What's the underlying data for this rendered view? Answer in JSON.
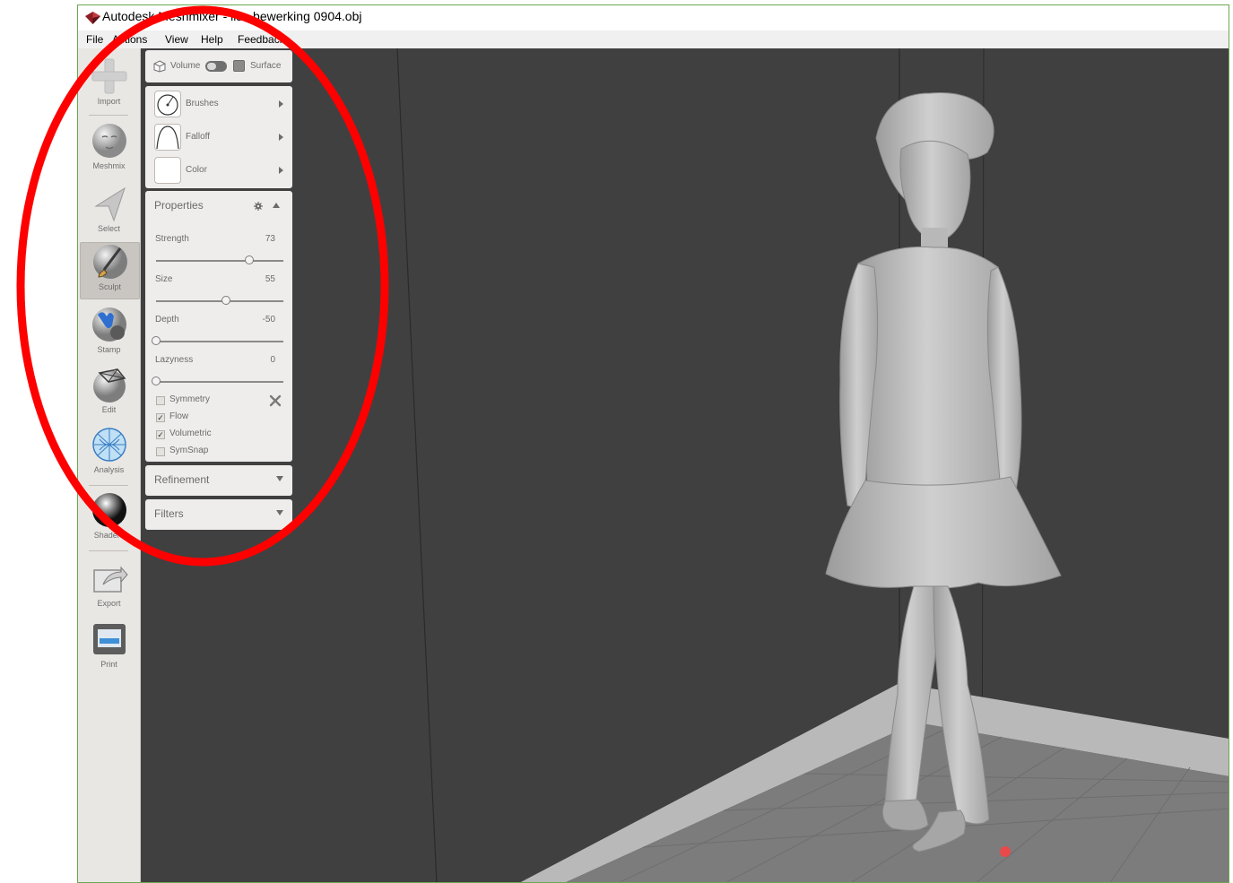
{
  "window": {
    "title": "Autodesk Meshmixer - lisa bewerking 0904.obj",
    "frame_color": "#6aa84f"
  },
  "menu": [
    "File",
    "Actions",
    "View",
    "Help",
    "Feedback"
  ],
  "toolbar": {
    "items": [
      {
        "label": "Import",
        "icon": "plus-icon"
      },
      {
        "label": "Meshmix",
        "icon": "meshmix-face-icon"
      },
      {
        "label": "Select",
        "icon": "select-arrow-icon"
      },
      {
        "label": "Sculpt",
        "icon": "sculpt-brush-icon",
        "active": true
      },
      {
        "label": "Stamp",
        "icon": "stamp-icon"
      },
      {
        "label": "Edit",
        "icon": "edit-icon"
      },
      {
        "label": "Analysis",
        "icon": "analysis-icon"
      },
      {
        "label": "Shaders",
        "icon": "shader-sphere-icon"
      },
      {
        "label": "Export",
        "icon": "export-icon"
      },
      {
        "label": "Print",
        "icon": "print-icon"
      }
    ]
  },
  "mode": {
    "volume_label": "Volume",
    "surface_label": "Surface",
    "selected": "Volume"
  },
  "brushes": {
    "items": [
      {
        "label": "Brushes",
        "icon": "brushes-icon"
      },
      {
        "label": "Falloff",
        "icon": "falloff-curve-icon"
      },
      {
        "label": "Color",
        "icon": "color-swatch-icon",
        "color": "#ffffff"
      }
    ]
  },
  "properties": {
    "title": "Properties",
    "sliders": [
      {
        "label": "Strength",
        "value": "73",
        "fraction": 0.73
      },
      {
        "label": "Size",
        "value": "55",
        "fraction": 0.55
      },
      {
        "label": "Depth",
        "value": "-50",
        "fraction": 0.0
      },
      {
        "label": "Lazyness",
        "value": "0",
        "fraction": 0.0
      }
    ],
    "checks": [
      {
        "label": "Symmetry",
        "checked": false
      },
      {
        "label": "Flow",
        "checked": true
      },
      {
        "label": "Volumetric",
        "checked": true
      },
      {
        "label": "SymSnap",
        "checked": false
      }
    ]
  },
  "refinement": {
    "title": "Refinement"
  },
  "filters": {
    "title": "Filters"
  },
  "colors": {
    "viewport": "#404040",
    "annotation": "#ff0000",
    "brush_dot": "#e84a4a"
  }
}
